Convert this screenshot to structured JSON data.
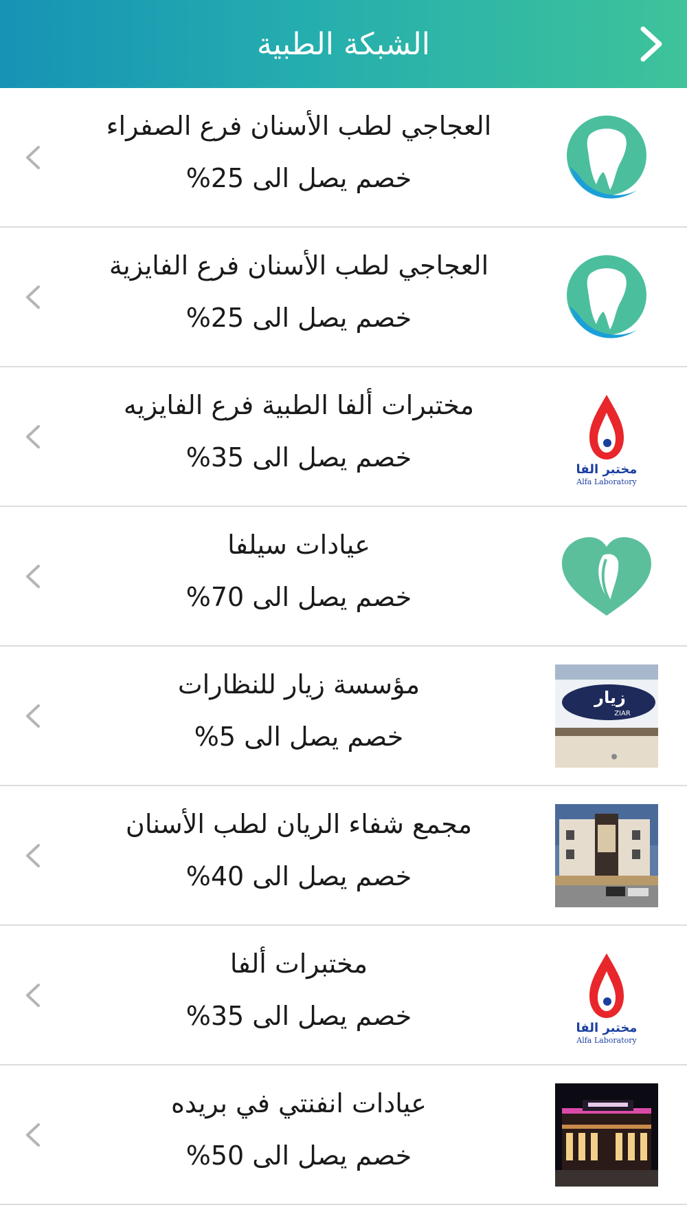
{
  "header": {
    "title": "الشبكة الطبية"
  },
  "items": [
    {
      "name": "العجاجي لطب الأسنان فرع الصفراء",
      "discount": "خصم يصل الى 25%",
      "logo": "tooth-logo-icon"
    },
    {
      "name": "العجاجي لطب الأسنان فرع الفايزية",
      "discount": "خصم يصل الى 25%",
      "logo": "tooth-logo-icon"
    },
    {
      "name": "مختبرات ألفا الطبية فرع الفايزيه",
      "discount": "خصم يصل الى 35%",
      "logo": "alfa-lab-logo",
      "logo_text_ar": "مختبر الفا",
      "logo_text_en": "Alfa Laboratory"
    },
    {
      "name": "عيادات سيلفا",
      "discount": "خصم يصل الى 70%",
      "logo": "heart-logo-icon"
    },
    {
      "name": "مؤسسة زيار للنظارات",
      "discount": "خصم يصل الى 5%",
      "logo": "ziar-storefront-photo",
      "logo_text_ar": "زيار",
      "logo_text_en": "ZIAR"
    },
    {
      "name": "مجمع شفاء الريان لطب الأسنان",
      "discount": "خصم يصل الى 40%",
      "logo": "building-photo"
    },
    {
      "name": "مختبرات ألفا",
      "discount": "خصم يصل الى 35%",
      "logo": "alfa-lab-logo",
      "logo_text_ar": "مختبر الفا",
      "logo_text_en": "Alfa Laboratory"
    },
    {
      "name": "عيادات انفنتي في بريده",
      "discount": "خصم يصل الى 50%",
      "logo": "night-building-photo"
    }
  ],
  "colors": {
    "header_start": "#1693b5",
    "header_end": "#3ec39a",
    "tooth_green": "#4bbf9d",
    "tooth_blue": "#1c9fd8",
    "alfa_red": "#e8262b",
    "alfa_blue": "#1b3fa0",
    "chevron_gray": "#b5b5b5"
  }
}
